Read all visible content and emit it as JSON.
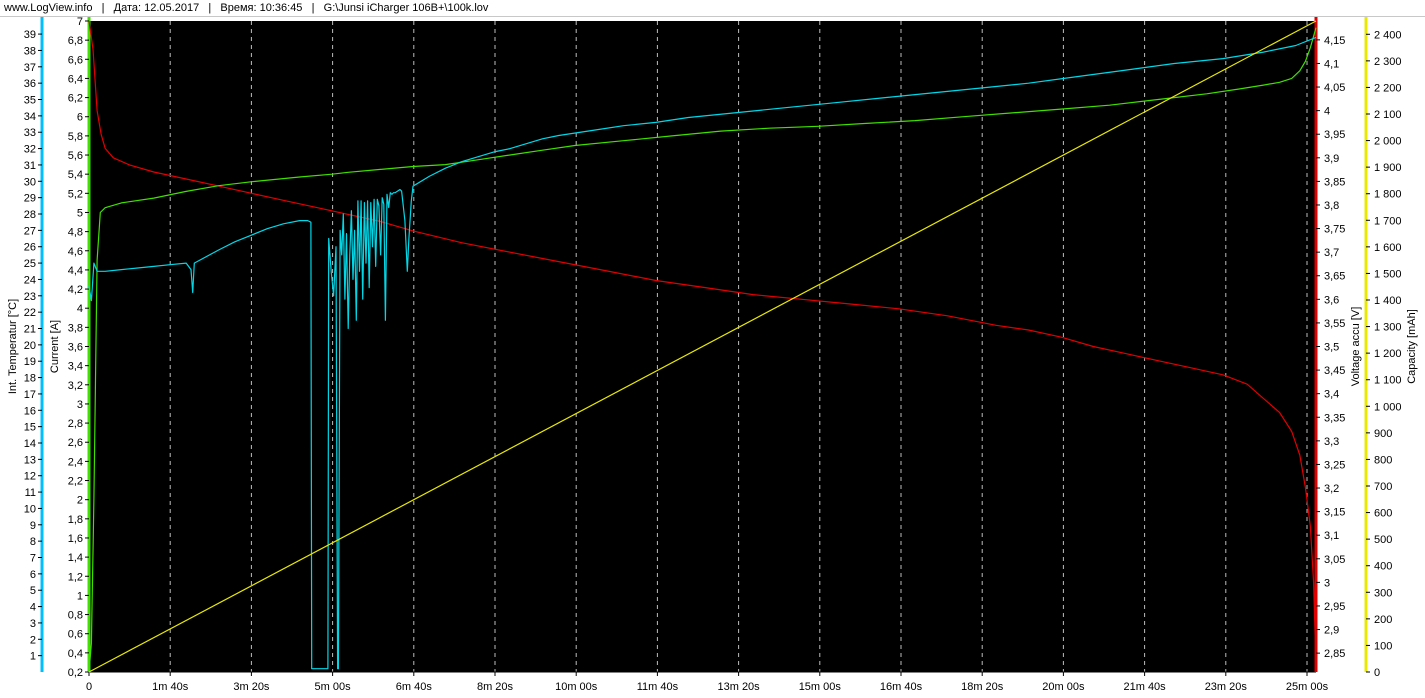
{
  "header": {
    "site": "www.LogView.info",
    "date_label": "Дата: 12.05.2017",
    "time_label": "Время: 10:36:45",
    "file_path": "G:\\Junsi iCharger 106B+\\100k.lov"
  },
  "chart_data": {
    "type": "line",
    "background": "#000000",
    "grid": "vertical dashed",
    "x_axis": {
      "ticks": [
        "0",
        "1m 40s",
        "3m 20s",
        "5m 00s",
        "6m 40s",
        "8m 20s",
        "10m 00s",
        "11m 40s",
        "13m 20s",
        "15m 00s",
        "16m 40s",
        "18m 20s",
        "20m 00s",
        "21m 40s",
        "23m 20s",
        "25m 00s"
      ],
      "range_s": [
        0,
        1515
      ]
    },
    "axes": {
      "temperature": {
        "label": "Int. Temperatur [°C]",
        "color": "#00bfff",
        "range": [
          0,
          39.8
        ],
        "ticks": [
          "1",
          "2",
          "3",
          "4",
          "5",
          "6",
          "7",
          "8",
          "9",
          "10",
          "11",
          "12",
          "13",
          "14",
          "15",
          "16",
          "17",
          "18",
          "19",
          "20",
          "21",
          "22",
          "23",
          "24",
          "25",
          "26",
          "27",
          "28",
          "29",
          "30",
          "31",
          "32",
          "33",
          "34",
          "35",
          "36",
          "37",
          "38",
          "39"
        ]
      },
      "current": {
        "label": "Current [A]",
        "color": "#40e000",
        "range": [
          0.2,
          7.0
        ],
        "ticks": [
          "0,2",
          "0,4",
          "0,6",
          "0,8",
          "1",
          "1,2",
          "1,4",
          "1,6",
          "1,8",
          "2",
          "2,2",
          "2,4",
          "2,6",
          "2,8",
          "3",
          "3,2",
          "3,4",
          "3,6",
          "3,8",
          "4",
          "4,2",
          "4,4",
          "4,6",
          "4,8",
          "5",
          "5,2",
          "5,4",
          "5,6",
          "5,8",
          "6",
          "6,2",
          "6,4",
          "6,6",
          "6,8",
          "7"
        ]
      },
      "voltage": {
        "label": "Voltage accu [V]",
        "color": "#e00000",
        "range": [
          2.81,
          4.19
        ],
        "ticks": [
          "2,85",
          "2,9",
          "2,95",
          "3",
          "3,05",
          "3,1",
          "3,15",
          "3,2",
          "3,25",
          "3,3",
          "3,35",
          "3,4",
          "3,45",
          "3,5",
          "3,55",
          "3,6",
          "3,65",
          "3,7",
          "3,75",
          "3,8",
          "3,85",
          "3,9",
          "3,95",
          "4",
          "4,05",
          "4,1",
          "4,15"
        ]
      },
      "capacity": {
        "label": "Capacity [mAh]",
        "color": "#e8e800",
        "range": [
          0,
          2450
        ],
        "ticks": [
          "0",
          "100",
          "200",
          "300",
          "400",
          "500",
          "600",
          "700",
          "800",
          "900",
          "1 000",
          "1 100",
          "1 200",
          "1 300",
          "1 400",
          "1 500",
          "1 600",
          "1 700",
          "1 800",
          "1 900",
          "2 000",
          "2 100",
          "2 200",
          "2 300",
          "2 400"
        ]
      }
    },
    "series": [
      {
        "axis": "voltage",
        "color": "#e00000",
        "points": [
          [
            0,
            4.19
          ],
          [
            5,
            4.13
          ],
          [
            10,
            4.0
          ],
          [
            15,
            3.95
          ],
          [
            20,
            3.92
          ],
          [
            30,
            3.9
          ],
          [
            50,
            3.885
          ],
          [
            80,
            3.87
          ],
          [
            120,
            3.855
          ],
          [
            160,
            3.84
          ],
          [
            200,
            3.825
          ],
          [
            240,
            3.81
          ],
          [
            280,
            3.795
          ],
          [
            320,
            3.78
          ],
          [
            360,
            3.765
          ],
          [
            400,
            3.745
          ],
          [
            460,
            3.72
          ],
          [
            520,
            3.7
          ],
          [
            580,
            3.68
          ],
          [
            640,
            3.66
          ],
          [
            700,
            3.64
          ],
          [
            760,
            3.625
          ],
          [
            820,
            3.61
          ],
          [
            880,
            3.6
          ],
          [
            940,
            3.59
          ],
          [
            1000,
            3.58
          ],
          [
            1060,
            3.565
          ],
          [
            1120,
            3.545
          ],
          [
            1160,
            3.535
          ],
          [
            1200,
            3.52
          ],
          [
            1240,
            3.5
          ],
          [
            1280,
            3.485
          ],
          [
            1320,
            3.47
          ],
          [
            1360,
            3.455
          ],
          [
            1400,
            3.44
          ],
          [
            1430,
            3.42
          ],
          [
            1450,
            3.39
          ],
          [
            1470,
            3.36
          ],
          [
            1485,
            3.32
          ],
          [
            1495,
            3.27
          ],
          [
            1502,
            3.2
          ],
          [
            1508,
            3.12
          ],
          [
            1512,
            3.0
          ],
          [
            1515,
            2.82
          ]
        ]
      },
      {
        "axis": "current",
        "color": "#40e000",
        "points": [
          [
            0,
            0.2
          ],
          [
            3,
            0.5
          ],
          [
            6,
            2.0
          ],
          [
            10,
            4.5
          ],
          [
            14,
            5.0
          ],
          [
            20,
            5.05
          ],
          [
            40,
            5.1
          ],
          [
            80,
            5.15
          ],
          [
            120,
            5.22
          ],
          [
            160,
            5.28
          ],
          [
            200,
            5.32
          ],
          [
            260,
            5.37
          ],
          [
            300,
            5.4
          ],
          [
            320,
            5.42
          ],
          [
            360,
            5.45
          ],
          [
            400,
            5.48
          ],
          [
            440,
            5.5
          ],
          [
            480,
            5.55
          ],
          [
            520,
            5.6
          ],
          [
            560,
            5.65
          ],
          [
            600,
            5.7
          ],
          [
            660,
            5.75
          ],
          [
            720,
            5.8
          ],
          [
            780,
            5.85
          ],
          [
            840,
            5.88
          ],
          [
            900,
            5.9
          ],
          [
            960,
            5.93
          ],
          [
            1020,
            5.96
          ],
          [
            1080,
            6.0
          ],
          [
            1140,
            6.04
          ],
          [
            1200,
            6.08
          ],
          [
            1260,
            6.12
          ],
          [
            1320,
            6.18
          ],
          [
            1380,
            6.24
          ],
          [
            1420,
            6.29
          ],
          [
            1450,
            6.33
          ],
          [
            1470,
            6.36
          ],
          [
            1485,
            6.4
          ],
          [
            1495,
            6.48
          ],
          [
            1502,
            6.58
          ],
          [
            1508,
            6.72
          ],
          [
            1515,
            6.93
          ]
        ]
      },
      {
        "axis": "temperature",
        "color": "#00d8e8",
        "points": [
          [
            0,
            23.6
          ],
          [
            3,
            22.7
          ],
          [
            6,
            25.0
          ],
          [
            10,
            24.5
          ],
          [
            20,
            24.5
          ],
          [
            40,
            24.6
          ],
          [
            60,
            24.7
          ],
          [
            80,
            24.8
          ],
          [
            100,
            24.9
          ],
          [
            120,
            25.0
          ],
          [
            126,
            24.6
          ],
          [
            128,
            23.2
          ],
          [
            130,
            25.0
          ],
          [
            160,
            25.8
          ],
          [
            180,
            26.3
          ],
          [
            200,
            26.7
          ],
          [
            220,
            27.1
          ],
          [
            240,
            27.4
          ],
          [
            260,
            27.6
          ],
          [
            270,
            27.6
          ],
          [
            274,
            27.5
          ],
          [
            275,
            0.2
          ],
          [
            276,
            0.2
          ],
          [
            295,
            0.2
          ],
          [
            296,
            26.5
          ],
          [
            299,
            24.5
          ],
          [
            302,
            23.0
          ],
          [
            305,
            26.0
          ],
          [
            307,
            0.2
          ],
          [
            308,
            0.2
          ],
          [
            310,
            27.0
          ],
          [
            312,
            25.5
          ],
          [
            314,
            28.0
          ],
          [
            316,
            22.8
          ],
          [
            318,
            26.8
          ],
          [
            320,
            21.0
          ],
          [
            322,
            25.5
          ],
          [
            324,
            28.2
          ],
          [
            326,
            24.0
          ],
          [
            328,
            27.0
          ],
          [
            330,
            21.5
          ],
          [
            332,
            28.8
          ],
          [
            334,
            24.5
          ],
          [
            336,
            28.8
          ],
          [
            338,
            22.8
          ],
          [
            340,
            28.7
          ],
          [
            342,
            25.0
          ],
          [
            344,
            28.8
          ],
          [
            346,
            23.5
          ],
          [
            348,
            28.7
          ],
          [
            350,
            26.0
          ],
          [
            352,
            28.9
          ],
          [
            354,
            24.8
          ],
          [
            356,
            28.9
          ],
          [
            358,
            28.5
          ],
          [
            360,
            25.5
          ],
          [
            362,
            29.0
          ],
          [
            364,
            28.6
          ],
          [
            366,
            21.5
          ],
          [
            368,
            29.2
          ],
          [
            370,
            28.4
          ],
          [
            372,
            29.3
          ],
          [
            374,
            29.2
          ],
          [
            376,
            29.3
          ],
          [
            378,
            29.3
          ],
          [
            384,
            29.5
          ],
          [
            386,
            29.4
          ],
          [
            390,
            27.6
          ],
          [
            393,
            24.5
          ],
          [
            395,
            26.5
          ],
          [
            398,
            28.8
          ],
          [
            400,
            29.7
          ],
          [
            420,
            30.3
          ],
          [
            440,
            30.8
          ],
          [
            460,
            31.2
          ],
          [
            480,
            31.5
          ],
          [
            500,
            31.8
          ],
          [
            520,
            32.0
          ],
          [
            540,
            32.3
          ],
          [
            560,
            32.6
          ],
          [
            580,
            32.8
          ],
          [
            620,
            33.1
          ],
          [
            660,
            33.4
          ],
          [
            700,
            33.6
          ],
          [
            740,
            33.9
          ],
          [
            800,
            34.2
          ],
          [
            860,
            34.5
          ],
          [
            920,
            34.8
          ],
          [
            980,
            35.1
          ],
          [
            1040,
            35.4
          ],
          [
            1100,
            35.7
          ],
          [
            1160,
            36.0
          ],
          [
            1220,
            36.4
          ],
          [
            1280,
            36.8
          ],
          [
            1340,
            37.2
          ],
          [
            1400,
            37.5
          ],
          [
            1450,
            37.9
          ],
          [
            1490,
            38.3
          ],
          [
            1515,
            38.8
          ]
        ]
      },
      {
        "axis": "capacity",
        "color": "#e8e800",
        "points": [
          [
            0,
            0
          ],
          [
            1515,
            2450
          ]
        ]
      }
    ]
  }
}
